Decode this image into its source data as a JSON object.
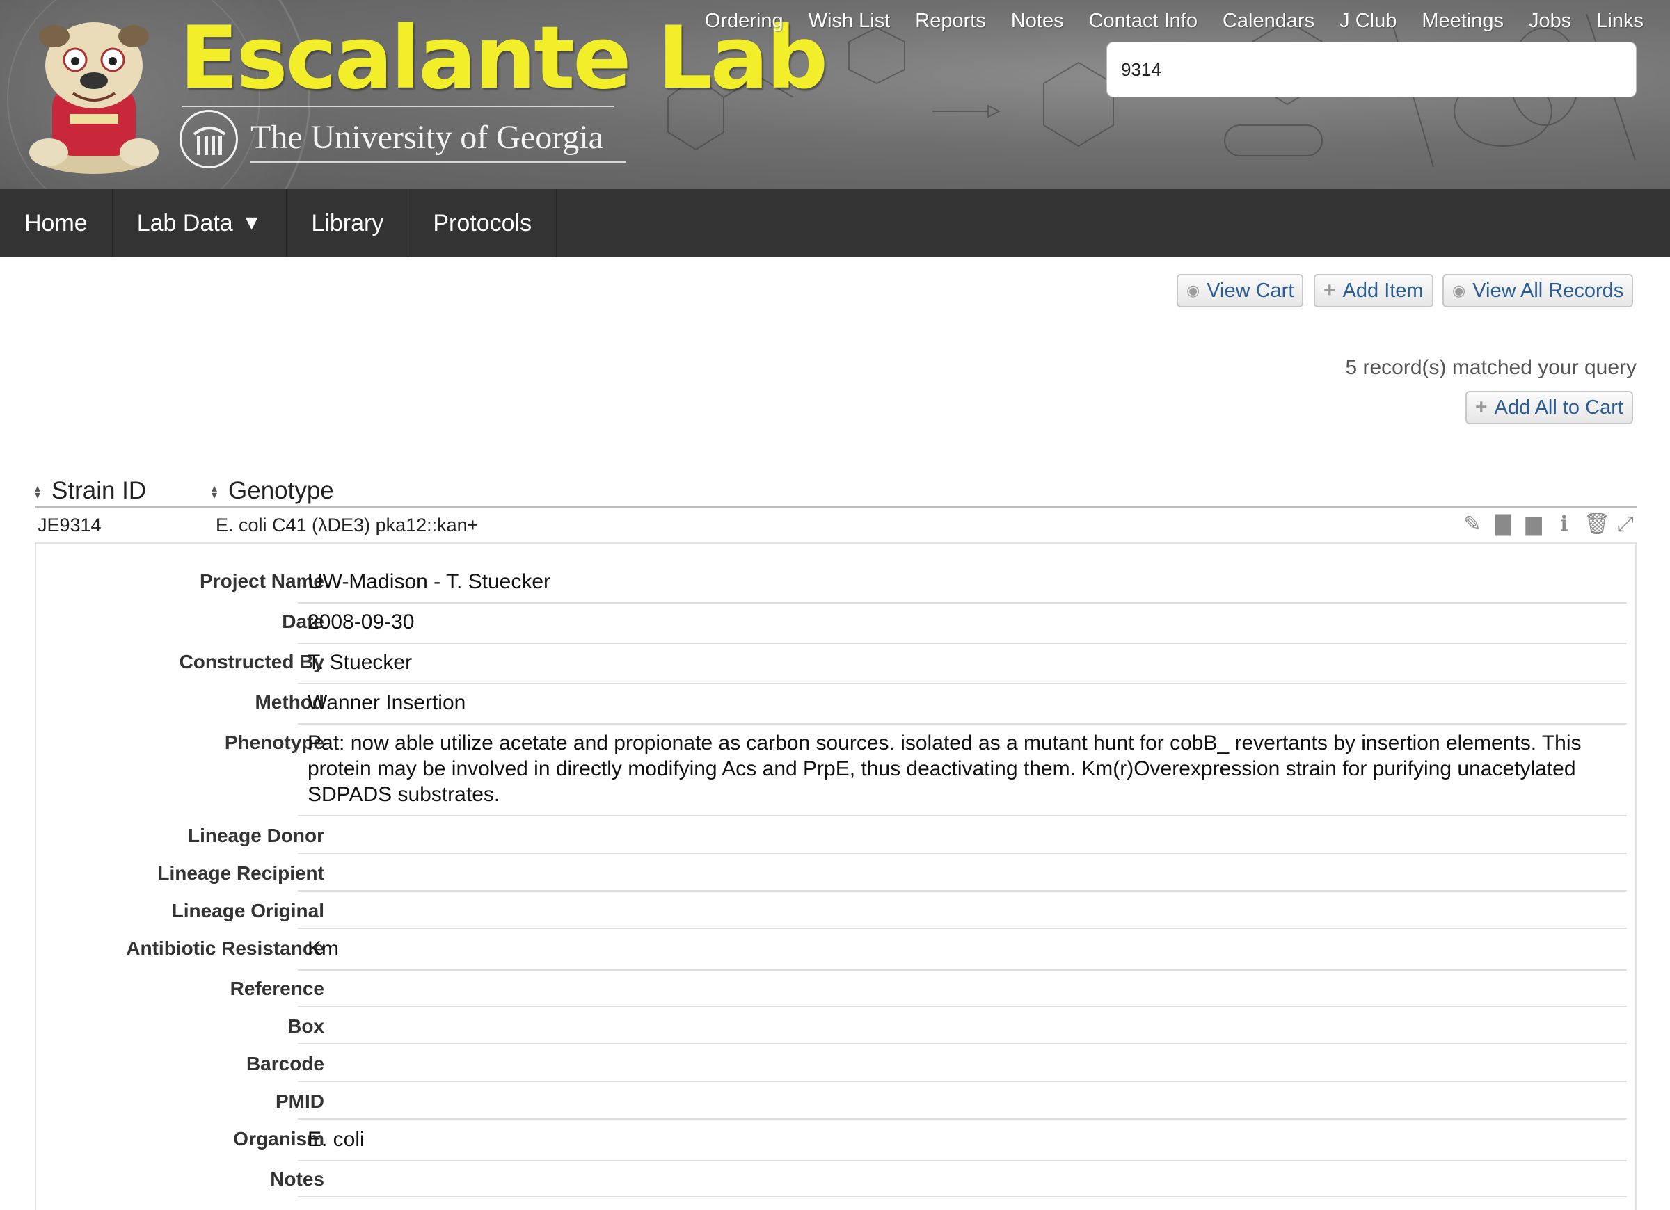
{
  "banner": {
    "title": "Escalante Lab",
    "university": "The University of Georgia",
    "logo_icons": [
      "bulldog-mascot-icon",
      "uga-arch-icon"
    ],
    "title_color": "#f2ef2a"
  },
  "topnav": {
    "items": [
      "Ordering",
      "Wish List",
      "Reports",
      "Notes",
      "Contact Info",
      "Calendars",
      "J Club",
      "Meetings",
      "Jobs",
      "Links"
    ]
  },
  "search": {
    "value": "9314"
  },
  "mainnav": {
    "items": [
      {
        "label": "Home"
      },
      {
        "label": "Lab Data",
        "has_dropdown": true,
        "arrow": "▼"
      },
      {
        "label": "Library"
      },
      {
        "label": "Protocols"
      }
    ],
    "background": "#333333"
  },
  "actions": {
    "view_cart": "View Cart",
    "add_item": "Add Item",
    "view_all": "View All Records",
    "add_all": "Add All to Cart",
    "link_color": "#2b5e96"
  },
  "results": {
    "matched_text": "5 record(s) matched your query",
    "columns": [
      "Strain ID",
      "Genotype"
    ],
    "row": {
      "strain_id": "JE9314",
      "genotype": "E. coli C41 (λDE3) pka12::kan+",
      "icons": [
        "edit-icon",
        "copy-icon",
        "file-icon",
        "info-icon",
        "delete-icon",
        "expand-icon"
      ]
    }
  },
  "detail": {
    "fields": [
      {
        "label": "Project Name",
        "value": "UW-Madison - T. Stuecker"
      },
      {
        "label": "Date",
        "value": "2008-09-30"
      },
      {
        "label": "Constructed By",
        "value": "T. Stuecker"
      },
      {
        "label": "Method",
        "value": "Wanner Insertion"
      },
      {
        "label": "Phenotype",
        "value": "Pat: now able utilize acetate and propionate as carbon sources. isolated as a mutant hunt for cobB_ revertants by insertion elements. This protein may be involved in directly modifying Acs and PrpE, thus deactivating them. Km(r)Overexpression strain for purifying unacetylated SDPADS substrates."
      },
      {
        "label": "Lineage Donor",
        "value": ""
      },
      {
        "label": "Lineage Recipient",
        "value": ""
      },
      {
        "label": "Lineage Original",
        "value": ""
      },
      {
        "label": "Antibiotic Resistance",
        "value": "Km"
      },
      {
        "label": "Reference",
        "value": ""
      },
      {
        "label": "Box",
        "value": ""
      },
      {
        "label": "Barcode",
        "value": ""
      },
      {
        "label": "PMID",
        "value": ""
      },
      {
        "label": "Organism",
        "value": "E. coli"
      },
      {
        "label": "Notes",
        "value": ""
      }
    ]
  }
}
